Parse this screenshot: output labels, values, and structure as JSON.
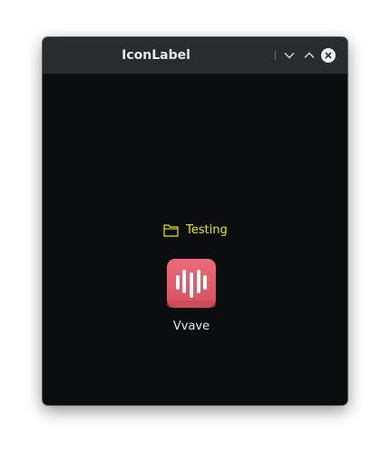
{
  "window": {
    "title": "IconLabel"
  },
  "titlebar_buttons": [
    {
      "name": "minimize",
      "icon": "chevron-down-icon"
    },
    {
      "name": "maximize",
      "icon": "chevron-up-icon"
    },
    {
      "name": "close",
      "icon": "close-icon"
    }
  ],
  "content": {
    "folder_label": "Testing",
    "folder_icon": "folder-icon",
    "app_label": "Vvave",
    "app_icon": "vvave-app-icon"
  },
  "colors": {
    "window_bg": "#0c0d0f",
    "titlebar_bg": "#2a2b2f",
    "folder_label": "#e6e600",
    "app_icon_bg": "#e0596a",
    "text": "#e8e8ea"
  }
}
